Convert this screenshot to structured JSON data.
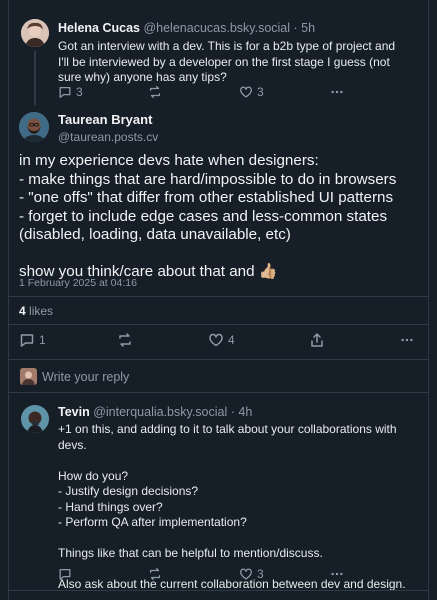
{
  "parent_post": {
    "author_name": "Helena Cucas",
    "author_handle": "@helenacucas.bsky.social",
    "separator": "·",
    "time": "5h",
    "text": "Got an interview with a dev. This is for a b2b type of project and I'll be interviewed by a developer on the first stage I guess (not sure why) anyone has any tips?",
    "reply_count": "3",
    "like_count": "3"
  },
  "main_post": {
    "author_name": "Taurean Bryant",
    "author_handle": "@taurean.posts.cv",
    "paragraphs": [
      "in my experience devs hate when designers:\n- make things that are hard/impossible to do in browsers\n- \"one offs\" that differ from other established UI patterns\n- forget to include edge cases and less-common states (disabled, loading, data unavailable, etc)",
      "show you think/care about that and 👍🏼"
    ],
    "timestamp": "1 February 2025 at 04:16",
    "likes_count": "4",
    "likes_label": "likes",
    "reply_count": "1",
    "like_count": "4"
  },
  "reply_composer": {
    "placeholder": "Write your reply"
  },
  "reply_post": {
    "author_name": "Tevin",
    "author_handle": "@interqualia.bsky.social",
    "separator": "·",
    "time": "4h",
    "paragraphs": [
      "+1 on this, and adding to it to talk about your collaborations with devs.",
      "How do you?\n- Justify design decisions?\n- Hand things over?\n- Perform QA after implementation?",
      "Things like that can be helpful to mention/discuss.",
      "Also ask about the current collaboration between dev and design."
    ],
    "like_count": "3"
  },
  "icons": {
    "reply": "speech-bubble-icon",
    "repost": "repost-arrows-icon",
    "like": "heart-icon",
    "share": "share-icon",
    "more": "ellipsis-icon"
  },
  "colors": {
    "background": "#161e27",
    "border": "#2e3a47",
    "text": "#f1f3f5",
    "muted": "#8d9aa8"
  }
}
